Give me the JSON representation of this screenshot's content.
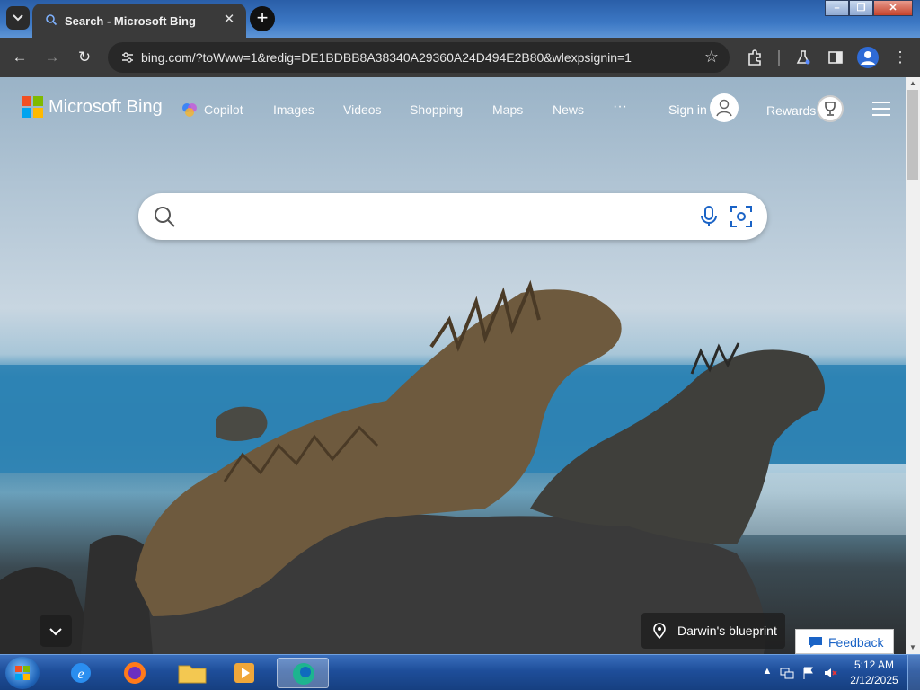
{
  "browser": {
    "tab_title": "Search - Microsoft Bing",
    "url": "bing.com/?toWww=1&redig=DE1BDBB8A38340A29360A24D494E2B80&wlexpsignin=1",
    "window_buttons": [
      "–",
      "❐",
      "✕"
    ]
  },
  "bing": {
    "logo_text": "Microsoft Bing",
    "nav": [
      "Copilot",
      "Images",
      "Videos",
      "Shopping",
      "Maps",
      "News",
      "···"
    ],
    "sign_in": "Sign in",
    "rewards": "Rewards",
    "search_placeholder": "",
    "image_caption": "Darwin's blueprint",
    "feedback": "Feedback"
  },
  "taskbar": {
    "time": "5:12 AM",
    "date": "2/12/2025"
  },
  "colors": {
    "titlebar": "#3c78c4",
    "toolbar": "#3a3a3a",
    "feedback_text": "#1a63c6"
  }
}
